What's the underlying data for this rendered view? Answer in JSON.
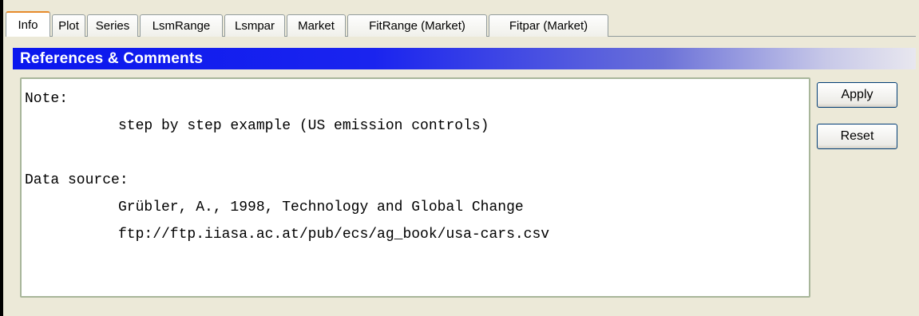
{
  "tabs": [
    {
      "label": "Info",
      "active": true
    },
    {
      "label": "Plot",
      "active": false
    },
    {
      "label": "Series",
      "active": false
    },
    {
      "label": "LsmRange",
      "active": false
    },
    {
      "label": "Lsmpar",
      "active": false
    },
    {
      "label": "Market",
      "active": false
    },
    {
      "label": "FitRange (Market)",
      "active": false
    },
    {
      "label": "Fitpar (Market)",
      "active": false
    }
  ],
  "section": {
    "title": "References & Comments"
  },
  "comments": {
    "lines": [
      "Note:",
      "step by step example (US emission controls)",
      "",
      "Data source:",
      "Grübler, A., 1998, Technology and Global Change",
      "ftp://ftp.iiasa.ac.at/pub/ecs/ag_book/usa-cars.csv"
    ]
  },
  "buttons": {
    "apply": "Apply",
    "reset": "Reset"
  },
  "colors": {
    "header_gradient_start": "#0a17ee",
    "header_gradient_end": "#e8e7ef",
    "panel_background": "#ece9d8",
    "active_tab_accent": "#e68b2c"
  }
}
